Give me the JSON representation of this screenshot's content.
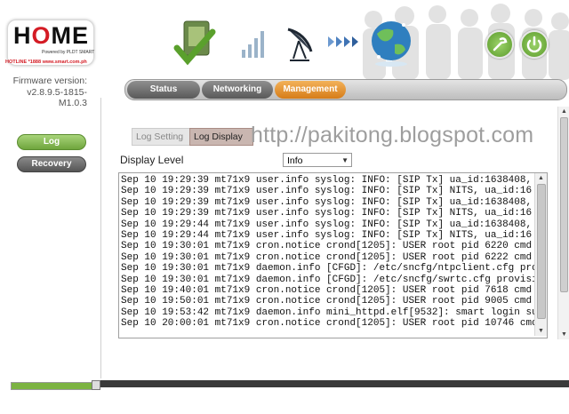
{
  "brand": {
    "logo_text_h": "H",
    "logo_text_o": "O",
    "logo_text_me": "ME",
    "powered_by": "Powered by PLDT SMART",
    "hotline": "HOTLINE *1888 www.smart.com.ph",
    "color_red": "#d41b24"
  },
  "firmware": {
    "label": "Firmware version:",
    "version_line1": "v2.8.9.5-1815-",
    "version_line2": "M1.0.3"
  },
  "nav": {
    "tabs": [
      {
        "label": "Status",
        "active": false
      },
      {
        "label": "Networking",
        "active": false
      },
      {
        "label": "Management",
        "active": true
      }
    ],
    "active_color": "#e08a22"
  },
  "sidebar": {
    "items": [
      {
        "label": "Log",
        "active": true
      },
      {
        "label": "Recovery",
        "active": false
      }
    ]
  },
  "subtabs": [
    {
      "label": "Log Setting",
      "active": false
    },
    {
      "label": "Log Display",
      "active": true
    }
  ],
  "watermark": "http://pakitong.blogspot.com",
  "display_level": {
    "label": "Display Level",
    "value": "Info"
  },
  "log": {
    "lines": [
      "Sep 10 19:29:39 mt71x9 user.info syslog: INFO: [SIP Tx] ua_id:1638408,",
      "Sep 10 19:29:39 mt71x9 user.info syslog: INFO: [SIP Tx] NITS, ua_id:16",
      "Sep 10 19:29:39 mt71x9 user.info syslog: INFO: [SIP Tx] ua_id:1638408,",
      "Sep 10 19:29:39 mt71x9 user.info syslog: INFO: [SIP Tx] NITS, ua_id:16",
      "Sep 10 19:29:44 mt71x9 user.info syslog: INFO: [SIP Tx] ua_id:1638408,",
      "Sep 10 19:29:44 mt71x9 user.info syslog: INFO: [SIP Tx] NITS, ua_id:16",
      "Sep 10 19:30:01 mt71x9 cron.notice crond[1205]: USER root pid 6220 cmd",
      "Sep 10 19:30:01 mt71x9 cron.notice crond[1205]: USER root pid 6222 cmd",
      "Sep 10 19:30:01 mt71x9 daemon.info [CFGD]: /etc/sncfg/ntpclient.cfg pro",
      "Sep 10 19:30:01 mt71x9 daemon.info [CFGD]: /etc/sncfg/swrtc.cfg provisi",
      "Sep 10 19:40:01 mt71x9 cron.notice crond[1205]: USER root pid 7618 cmd",
      "Sep 10 19:50:01 mt71x9 cron.notice crond[1205]: USER root pid 9005 cmd",
      "Sep 10 19:53:42 mt71x9 daemon.info mini_httpd.elf[9532]: smart login su",
      "Sep 10 20:00:01 mt71x9 cron.notice crond[1205]: USER root pid 10746 cmd"
    ]
  },
  "icons": [
    "device-check-icon",
    "signal-bars-icon",
    "satellite-dish-icon",
    "arrows-forward-icon",
    "globe-icon",
    "tools-icon",
    "power-icon"
  ]
}
